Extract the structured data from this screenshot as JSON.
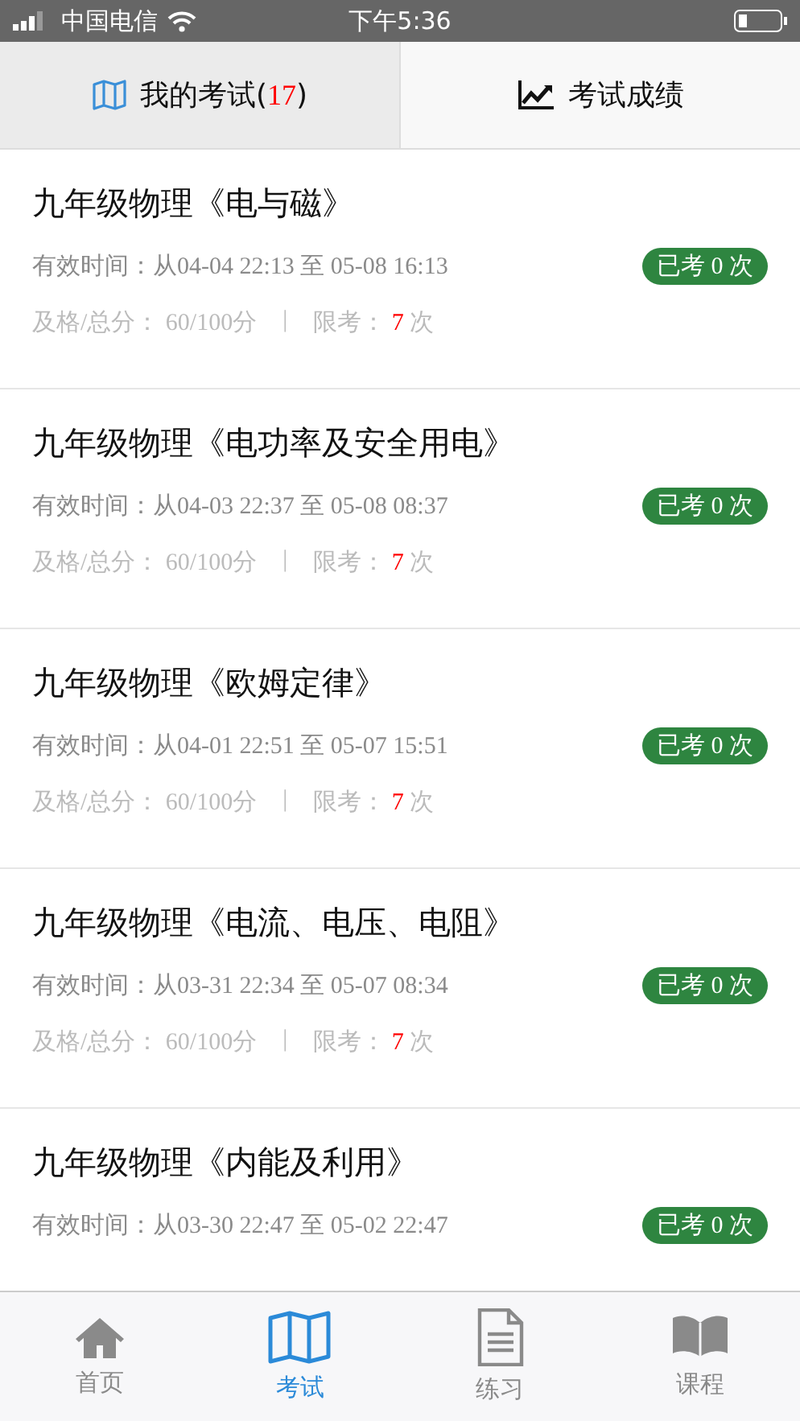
{
  "status_bar": {
    "carrier": "中国电信",
    "time": "下午5:36"
  },
  "tabs": [
    {
      "label": "我的考试",
      "count_open": "(",
      "count": "17",
      "count_close": ")",
      "selected": true
    },
    {
      "label": "考试成绩",
      "selected": false
    }
  ],
  "exams": [
    {
      "title": "九年级物理《电与磁》",
      "time_label": "有效时间：",
      "time": "从04-04 22:13 至 05-08 16:13",
      "badge": "已考 0 次",
      "pass_label": "及格/总分：",
      "pass": "60/100分",
      "separator": "|",
      "limit_label": "限考：",
      "limit": "7",
      "limit_unit": "次"
    },
    {
      "title": "九年级物理《电功率及安全用电》",
      "time_label": "有效时间：",
      "time": "从04-03 22:37 至 05-08 08:37",
      "badge": "已考 0 次",
      "pass_label": "及格/总分：",
      "pass": "60/100分",
      "separator": "|",
      "limit_label": "限考：",
      "limit": "7",
      "limit_unit": "次"
    },
    {
      "title": "九年级物理《欧姆定律》",
      "time_label": "有效时间：",
      "time": "从04-01 22:51 至 05-07 15:51",
      "badge": "已考 0 次",
      "pass_label": "及格/总分：",
      "pass": "60/100分",
      "separator": "|",
      "limit_label": "限考：",
      "limit": "7",
      "limit_unit": "次"
    },
    {
      "title": "九年级物理《电流、电压、电阻》",
      "time_label": "有效时间：",
      "time": "从03-31 22:34 至 05-07 08:34",
      "badge": "已考 0 次",
      "pass_label": "及格/总分：",
      "pass": "60/100分",
      "separator": "|",
      "limit_label": "限考：",
      "limit": "7",
      "limit_unit": "次"
    },
    {
      "title": "九年级物理《内能及利用》",
      "time_label": "有效时间：",
      "time": "从03-30 22:47 至 05-02 22:47",
      "badge": "已考 0 次"
    }
  ],
  "bottom_nav": [
    {
      "label": "首页",
      "selected": false
    },
    {
      "label": "考试",
      "selected": true
    },
    {
      "label": "练习",
      "selected": false
    },
    {
      "label": "课程",
      "selected": false
    }
  ]
}
